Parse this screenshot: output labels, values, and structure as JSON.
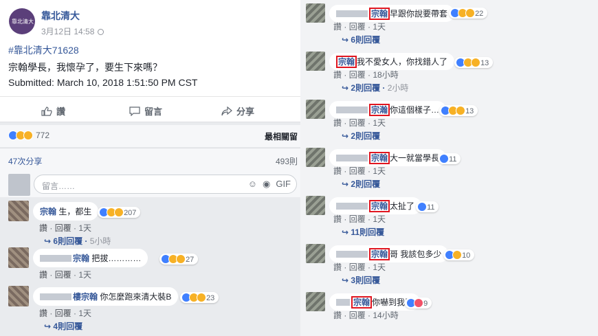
{
  "left": {
    "page_name": "靠北清大",
    "avatar_text": "靠北清大",
    "post_time": "3月12日 14:58",
    "hashtag": "#靠北清大71628",
    "post_text": "宗翰學長，我懷孕了，要生下來嗎？",
    "submitted": "Submitted: March 10, 2018 1:51:50 PM CST",
    "actions": {
      "like": "讚",
      "comment": "留言",
      "share": "分享"
    },
    "reaction_count": "772",
    "top_comments_label": "最相關留",
    "share_count": "47次分享",
    "comment_total": "493則",
    "composer_placeholder": "留言……",
    "composer_gif": "GIF",
    "comments": [
      {
        "name": "宗翰",
        "text": "生，都生",
        "reacts": "207",
        "like": "讚",
        "reply": "回覆",
        "time": "1天",
        "replies": "6則回覆",
        "replies_time": "5小時"
      },
      {
        "name": "宗翰",
        "text": "把拔…………",
        "reacts": "27",
        "like": "讚",
        "reply": "回覆",
        "time": "1天"
      },
      {
        "name": "樓宗翰",
        "text": "你怎麼跑來清大裝B",
        "reacts": "23",
        "like": "讚",
        "reply": "回覆",
        "time": "1天",
        "replies": "4則回覆"
      }
    ]
  },
  "right": {
    "comments": [
      {
        "name": "宗翰",
        "text": "早跟你說要帶套",
        "reacts": "22",
        "like": "讚",
        "reply": "回覆",
        "time": "1天",
        "replies": "6則回覆"
      },
      {
        "name": "宗翰",
        "text": "我不愛女人，你找錯人了",
        "reacts": "13",
        "like": "讚",
        "reply": "回覆",
        "time": "18小時",
        "replies": "2則回覆",
        "replies_time": "2小時"
      },
      {
        "name": "宗瀚",
        "text": "你這個樣子…",
        "reacts": "13",
        "like": "讚",
        "reply": "回覆",
        "time": "1天",
        "replies": "2則回覆"
      },
      {
        "name": "宗翰",
        "text": "大一就當學長",
        "reacts": "11",
        "like": "讚",
        "reply": "回覆",
        "time": "1天",
        "replies": "2則回覆"
      },
      {
        "name": "宗翰",
        "text": "太扯了",
        "reacts": "11",
        "like": "讚",
        "reply": "回覆",
        "time": "1天",
        "replies": "11則回覆"
      },
      {
        "name": "宗翰",
        "text": "哥 我該包多少",
        "reacts": "10",
        "like": "讚",
        "reply": "回覆",
        "time": "1天",
        "replies": "3則回覆"
      },
      {
        "name": "宗翰",
        "text": "你嚇到我了",
        "reacts": "9",
        "like": "讚",
        "reply": "回覆",
        "time": "14小時"
      }
    ]
  },
  "colors": {
    "link": "#365899",
    "highlight": "#e0151f",
    "page_avatar": "#5b3f7a"
  }
}
